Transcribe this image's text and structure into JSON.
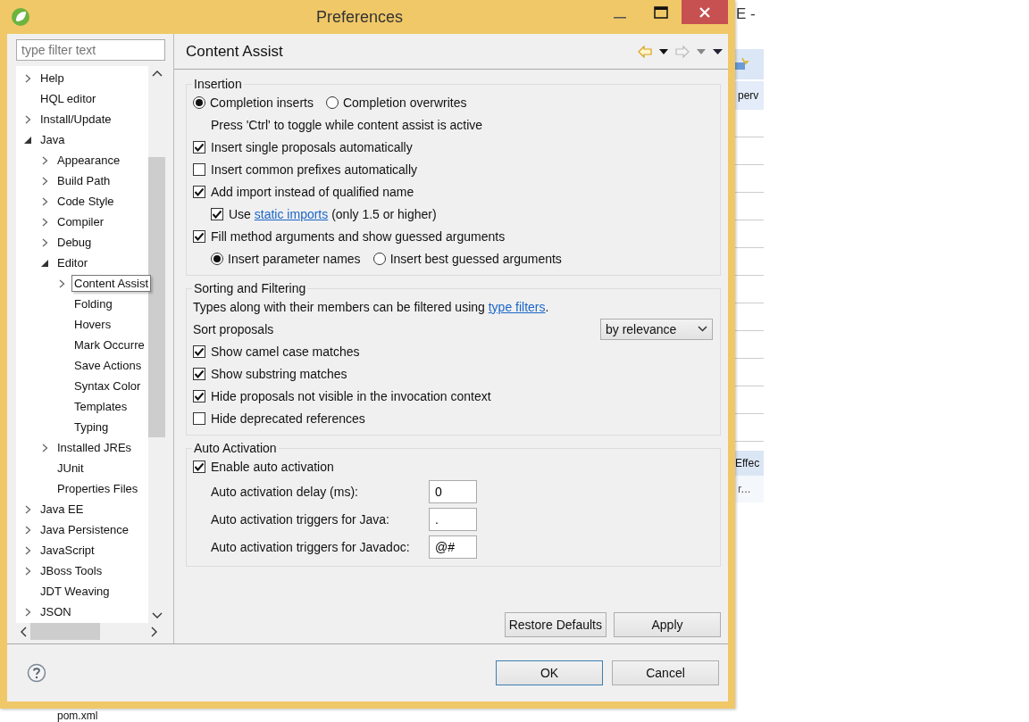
{
  "background_window": {
    "title": "E -",
    "tab": "perv",
    "panel_tab": "Effec",
    "panel_text": "r...",
    "file": "pom.xml"
  },
  "window": {
    "title": "Preferences"
  },
  "filter": {
    "placeholder": "type filter text"
  },
  "tree": [
    {
      "label": "Help",
      "kind": "node",
      "expanded": false,
      "selected": false
    },
    {
      "label": "HQL editor",
      "kind": "leaf",
      "selected": false
    },
    {
      "label": "Install/Update",
      "kind": "node",
      "expanded": false,
      "selected": false
    },
    {
      "label": "Java",
      "kind": "node",
      "expanded": true,
      "selected": false,
      "children": [
        {
          "label": "Appearance",
          "kind": "node",
          "expanded": false,
          "selected": false
        },
        {
          "label": "Build Path",
          "kind": "node",
          "expanded": false,
          "selected": false
        },
        {
          "label": "Code Style",
          "kind": "node",
          "expanded": false,
          "selected": false
        },
        {
          "label": "Compiler",
          "kind": "node",
          "expanded": false,
          "selected": false
        },
        {
          "label": "Debug",
          "kind": "node",
          "expanded": false,
          "selected": false
        },
        {
          "label": "Editor",
          "kind": "node",
          "expanded": true,
          "selected": false,
          "children": [
            {
              "label": "Content Assist",
              "kind": "node",
              "expanded": false,
              "selected": true
            },
            {
              "label": "Folding",
              "kind": "leaf",
              "selected": false
            },
            {
              "label": "Hovers",
              "kind": "leaf",
              "selected": false
            },
            {
              "label": "Mark Occurre",
              "kind": "leaf",
              "selected": false
            },
            {
              "label": "Save Actions",
              "kind": "leaf",
              "selected": false
            },
            {
              "label": "Syntax Color",
              "kind": "leaf",
              "selected": false
            },
            {
              "label": "Templates",
              "kind": "leaf",
              "selected": false
            },
            {
              "label": "Typing",
              "kind": "leaf",
              "selected": false
            }
          ]
        },
        {
          "label": "Installed JREs",
          "kind": "node",
          "expanded": false,
          "selected": false
        },
        {
          "label": "JUnit",
          "kind": "leaf",
          "selected": false
        },
        {
          "label": "Properties Files",
          "kind": "leaf",
          "selected": false
        }
      ]
    },
    {
      "label": "Java EE",
      "kind": "node",
      "expanded": false,
      "selected": false
    },
    {
      "label": "Java Persistence",
      "kind": "node",
      "expanded": false,
      "selected": false
    },
    {
      "label": "JavaScript",
      "kind": "node",
      "expanded": false,
      "selected": false
    },
    {
      "label": "JBoss Tools",
      "kind": "node",
      "expanded": false,
      "selected": false
    },
    {
      "label": "JDT Weaving",
      "kind": "leaf",
      "selected": false
    },
    {
      "label": "JSON",
      "kind": "node",
      "expanded": false,
      "selected": false
    }
  ],
  "page": {
    "title": "Content Assist",
    "back_disabled": false,
    "forward_disabled": true
  },
  "groups": [
    {
      "title": "Insertion",
      "items": [
        {
          "kind": "radios",
          "options": [
            {
              "label": "Completion inserts",
              "selected": true
            },
            {
              "label": "Completion overwrites",
              "selected": false
            }
          ]
        },
        {
          "kind": "note",
          "text": "Press 'Ctrl' to toggle while content assist is active"
        },
        {
          "kind": "checkbox",
          "label": "Insert single proposals automatically",
          "checked": true
        },
        {
          "kind": "checkbox",
          "label": "Insert common prefixes automatically",
          "checked": false
        },
        {
          "kind": "checkbox",
          "label": "Add import instead of qualified name",
          "checked": true,
          "children": [
            {
              "kind": "checkbox",
              "label": "Use",
              "link": "static imports",
              "after": "(only 1.5 or higher)",
              "checked": true
            }
          ]
        },
        {
          "kind": "checkbox",
          "label": "Fill method arguments and show guessed arguments",
          "checked": true,
          "children": [
            {
              "kind": "radios",
              "options": [
                {
                  "label": "Insert parameter names",
                  "selected": true
                },
                {
                  "label": "Insert best guessed arguments",
                  "selected": false
                }
              ]
            }
          ]
        }
      ]
    },
    {
      "title": "Sorting and Filtering",
      "items": [
        {
          "kind": "info",
          "text": "Types along with their members can be filtered using",
          "link": "type filters",
          "after": "."
        },
        {
          "kind": "dropdown",
          "label": "Sort proposals",
          "value": "by relevance"
        },
        {
          "kind": "checkbox",
          "label": "Show camel case matches",
          "checked": true
        },
        {
          "kind": "checkbox",
          "label": "Show substring matches",
          "checked": true
        },
        {
          "kind": "checkbox",
          "label": "Hide proposals not visible in the invocation context",
          "checked": true
        },
        {
          "kind": "checkbox",
          "label": "Hide deprecated references",
          "checked": false
        }
      ]
    },
    {
      "title": "Auto Activation",
      "items": [
        {
          "kind": "checkbox",
          "label": "Enable auto activation",
          "checked": true
        },
        {
          "kind": "field",
          "label": "Auto activation delay (ms):",
          "value": "0"
        },
        {
          "kind": "field",
          "label": "Auto activation triggers for Java:",
          "value": "."
        },
        {
          "kind": "field",
          "label": "Auto activation triggers for Javadoc:",
          "value": "@#"
        }
      ]
    }
  ],
  "page_buttons": [
    "Restore Defaults",
    "Apply"
  ],
  "dialog_buttons": [
    {
      "label": "OK",
      "default": true
    },
    {
      "label": "Cancel",
      "default": false
    }
  ]
}
